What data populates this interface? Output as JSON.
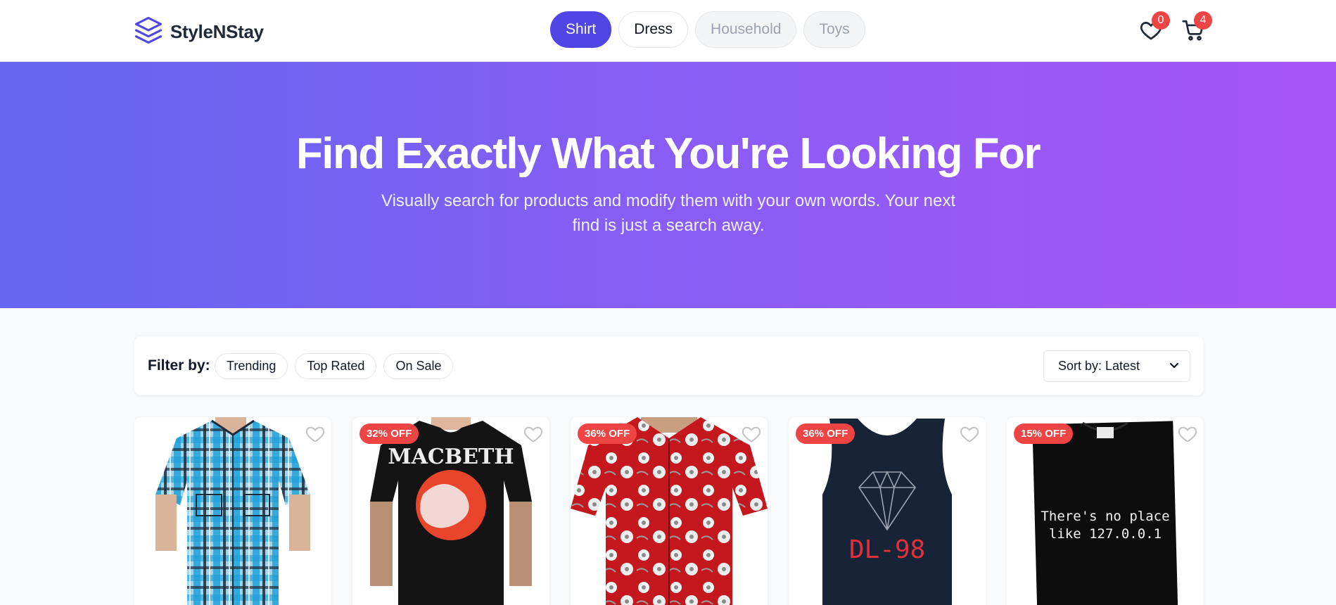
{
  "brand": {
    "name": "StyleNStay",
    "logo_icon": "layers-icon",
    "accent": "#4f46e5"
  },
  "categories": [
    {
      "label": "Shirt",
      "state": "active"
    },
    {
      "label": "Dress",
      "state": "normal"
    },
    {
      "label": "Household",
      "state": "disabled"
    },
    {
      "label": "Toys",
      "state": "disabled"
    }
  ],
  "header_actions": {
    "wishlist": {
      "icon": "heart-icon",
      "count": "0"
    },
    "cart": {
      "icon": "cart-icon",
      "count": "4"
    }
  },
  "hero": {
    "title": "Find Exactly What You're Looking For",
    "subtitle": "Visually search for products and modify them with your own words. Your next find is just a search away.",
    "gradient": [
      "#6366f1",
      "#a855f7"
    ]
  },
  "filters": {
    "label": "Filter by:",
    "chips": [
      "Trending",
      "Top Rated",
      "On Sale"
    ],
    "sort": {
      "selected": "Sort by: Latest"
    }
  },
  "products": [
    {
      "discount": "",
      "image": "plaid-shirt-photo"
    },
    {
      "discount": "32% OFF",
      "image": "macbeth-tshirt-photo",
      "print_text": "MACBETH"
    },
    {
      "discount": "36% OFF",
      "image": "hawaiian-shirt-photo"
    },
    {
      "discount": "36% OFF",
      "image": "diamond-tank-top-photo",
      "print_text": "DL-98"
    },
    {
      "discount": "15% OFF",
      "image": "black-tshirt-photo",
      "print_text": "There's no place like 127.0.0.1"
    }
  ]
}
